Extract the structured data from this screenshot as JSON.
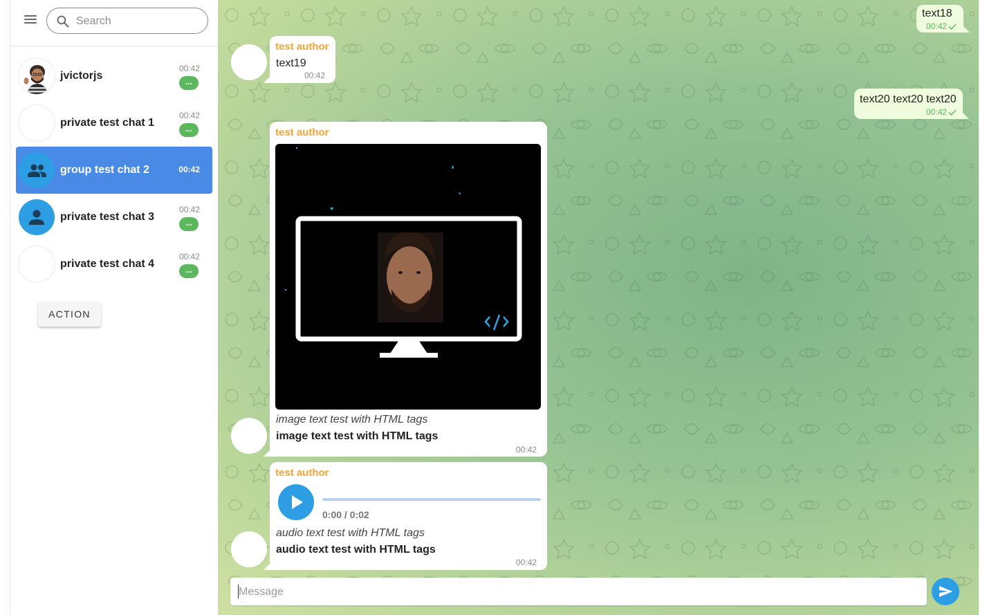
{
  "search": {
    "placeholder": "Search"
  },
  "chats": [
    {
      "name": "jvictorjs",
      "time": "00:42",
      "badge": "...",
      "avatar": "user-photo",
      "active": false
    },
    {
      "name": "private test chat 1",
      "time": "00:42",
      "badge": "...",
      "avatar": "blank",
      "active": false
    },
    {
      "name": "group test chat 2",
      "time": "00:42",
      "badge": "",
      "avatar": "group-icon",
      "active": true
    },
    {
      "name": "private test chat 3",
      "time": "00:42",
      "badge": "...",
      "avatar": "person-icon",
      "active": false
    },
    {
      "name": "private test chat 4",
      "time": "00:42",
      "badge": "...",
      "avatar": "blank",
      "active": false
    }
  ],
  "sidebar": {
    "action_label": "ACTION"
  },
  "messages": {
    "m18": {
      "text": "text18",
      "time": "00:42",
      "direction": "out",
      "status": "check-icon"
    },
    "m19": {
      "author": "test author",
      "text": "text19",
      "time": "00:42",
      "direction": "in"
    },
    "m20": {
      "text": "text20 text20 text20",
      "time": "00:42",
      "direction": "out",
      "status": "check-icon"
    },
    "image": {
      "author": "test author",
      "caption_italic": "image text test with HTML tags",
      "caption_bold": "image text test with HTML tags",
      "time": "00:42",
      "direction": "in"
    },
    "audio": {
      "author": "test author",
      "player_time": "0:00 / 0:02",
      "caption_italic": "audio text test with HTML tags",
      "caption_bold": "audio text test with HTML tags",
      "time": "00:42",
      "direction": "in"
    }
  },
  "composer": {
    "placeholder": "Message"
  },
  "colors": {
    "accent": "#2d9ee4",
    "active_chat": "#4a8ae7",
    "badge": "#5cb85c",
    "author": "#f3a43b",
    "outgoing_bubble": "#effdde"
  }
}
